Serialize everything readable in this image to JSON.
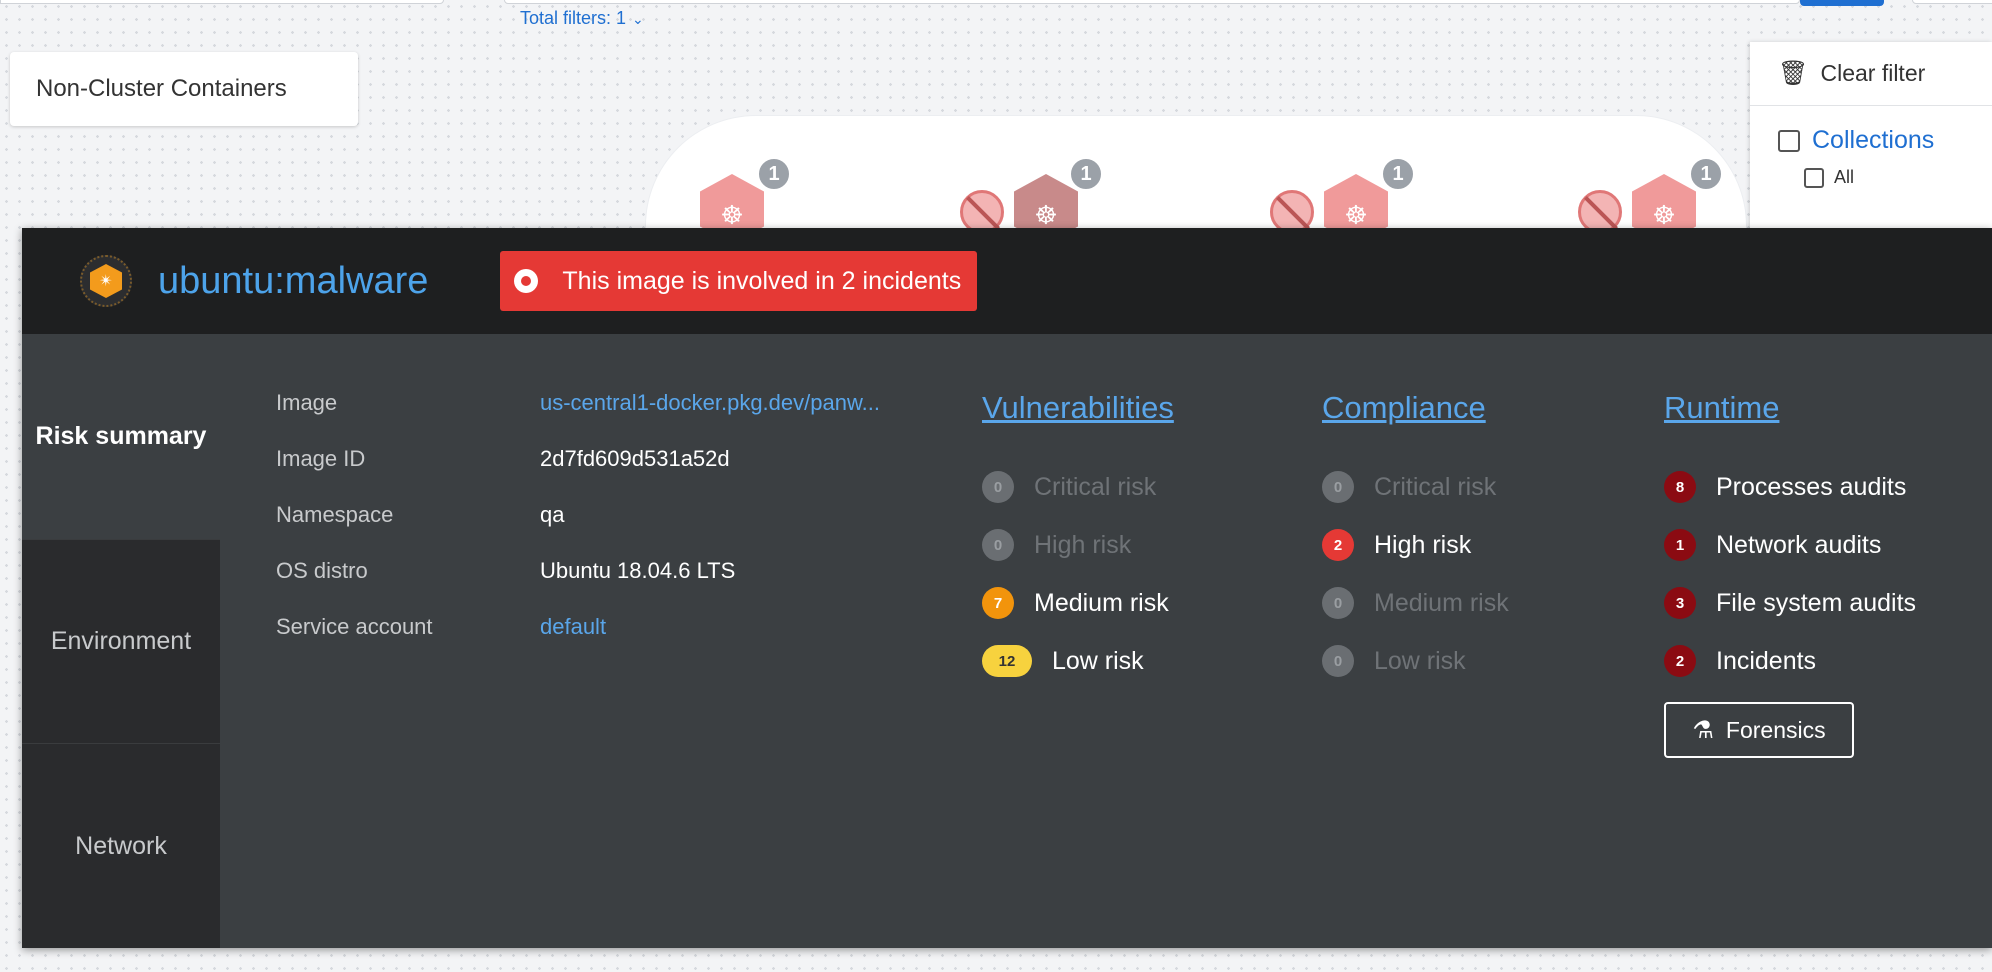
{
  "topbar": {
    "total_filters": "Total filters: 1"
  },
  "map": {
    "non_cluster_label": "Non-Cluster Containers",
    "node_counts": [
      "1",
      "1",
      "1",
      "1"
    ]
  },
  "filter_panel": {
    "clear_label": "Clear filter",
    "collections_label": "Collections",
    "all_label": "All"
  },
  "detail": {
    "title": "ubuntu:malware",
    "alert": "This image is involved in 2 incidents",
    "tabs": [
      "Risk summary",
      "Environment",
      "Network"
    ],
    "info": [
      {
        "key": "Image",
        "value": "us-central1-docker.pkg.dev/panw..."
      },
      {
        "key": "Image ID",
        "value": "2d7fd609d531a52d"
      },
      {
        "key": "Namespace",
        "value": "qa"
      },
      {
        "key": "OS distro",
        "value": "Ubuntu 18.04.6 LTS"
      },
      {
        "key": "Service account",
        "value": "default"
      }
    ],
    "vulnerabilities": {
      "title": "Vulnerabilities",
      "items": [
        {
          "count": "0",
          "label": "Critical risk"
        },
        {
          "count": "0",
          "label": "High risk"
        },
        {
          "count": "7",
          "label": "Medium risk"
        },
        {
          "count": "12",
          "label": "Low risk"
        }
      ]
    },
    "compliance": {
      "title": "Compliance",
      "items": [
        {
          "count": "0",
          "label": "Critical risk"
        },
        {
          "count": "2",
          "label": "High risk"
        },
        {
          "count": "0",
          "label": "Medium risk"
        },
        {
          "count": "0",
          "label": "Low risk"
        }
      ]
    },
    "runtime": {
      "title": "Runtime",
      "items": [
        {
          "count": "8",
          "label": "Processes audits"
        },
        {
          "count": "1",
          "label": "Network audits"
        },
        {
          "count": "3",
          "label": "File system audits"
        },
        {
          "count": "2",
          "label": "Incidents"
        }
      ],
      "forensics_label": "Forensics"
    }
  },
  "colors": {
    "accent_blue": "#4da3ea",
    "alert_red": "#e53935",
    "medium_orange": "#f2940c",
    "low_yellow": "#f7d23e",
    "runtime_maroon": "#8b0b12"
  }
}
